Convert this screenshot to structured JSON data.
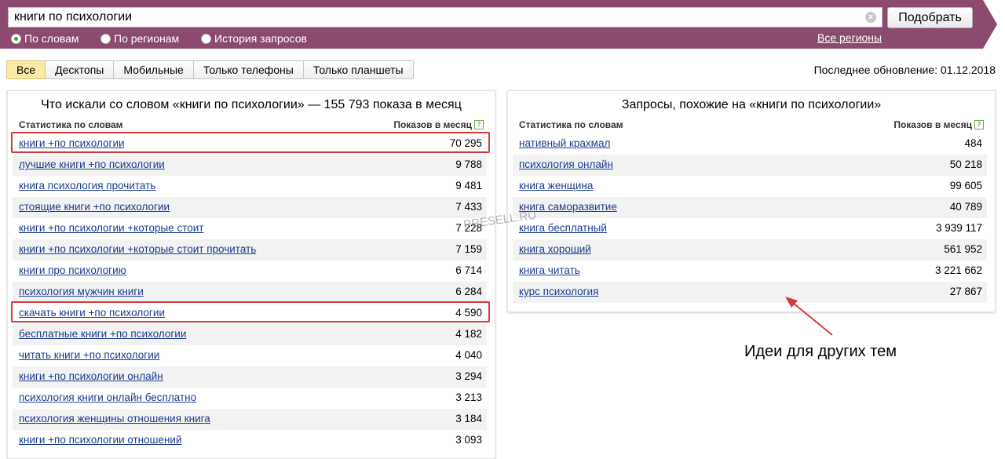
{
  "colors": {
    "header_band": "#8c4b6e",
    "link": "#1a3b8e",
    "highlight": "#d53a3a",
    "active_tab": "#fbe9a6"
  },
  "search": {
    "query": "книги по психологии",
    "button_label": "Подобрать",
    "clear_icon": "×"
  },
  "modes": [
    {
      "label": "По словам",
      "selected": true
    },
    {
      "label": "По регионам",
      "selected": false
    },
    {
      "label": "История запросов",
      "selected": false
    }
  ],
  "all_regions_label": "Все регионы",
  "device_tabs": [
    {
      "label": "Все",
      "active": true
    },
    {
      "label": "Десктопы",
      "active": false
    },
    {
      "label": "Мобильные",
      "active": false
    },
    {
      "label": "Только телефоны",
      "active": false
    },
    {
      "label": "Только планшеты",
      "active": false
    }
  ],
  "last_update": "Последнее обновление: 01.12.2018",
  "left_panel": {
    "title": "Что искали со словом «книги по психологии» — 155 793 показа в месяц",
    "col_query": "Статистика по словам",
    "col_count": "Показов в месяц",
    "help_icon": "?",
    "rows": [
      {
        "query": "книги +по психологии",
        "count": "70 295",
        "highlighted": true
      },
      {
        "query": "лучшие книги +по психологии",
        "count": "9 788"
      },
      {
        "query": "книга психология прочитать",
        "count": "9 481"
      },
      {
        "query": "стоящие книги +по психологии",
        "count": "7 433"
      },
      {
        "query": "книги +по психологии +которые стоит",
        "count": "7 228"
      },
      {
        "query": "книги +по психологии +которые стоит прочитать",
        "count": "7 159"
      },
      {
        "query": "книги про психологию",
        "count": "6 714"
      },
      {
        "query": "психология мужчин книги",
        "count": "6 284"
      },
      {
        "query": "скачать книги +по психологии",
        "count": "4 590",
        "highlighted": true
      },
      {
        "query": "бесплатные книги +по психологии",
        "count": "4 182"
      },
      {
        "query": "читать книги +по психологии",
        "count": "4 040"
      },
      {
        "query": "книги +по психологии онлайн",
        "count": "3 294"
      },
      {
        "query": "психология книги онлайн бесплатно",
        "count": "3 213"
      },
      {
        "query": "психология женщины отношения книга",
        "count": "3 184"
      },
      {
        "query": "книги +по психологии отношений",
        "count": "3 093"
      }
    ]
  },
  "right_panel": {
    "title": "Запросы, похожие на «книги по психологии»",
    "col_query": "Статистика по словам",
    "col_count": "Показов в месяц",
    "help_icon": "?",
    "rows": [
      {
        "query": "нативный крахмал",
        "count": "484"
      },
      {
        "query": "психология онлайн",
        "count": "50 218"
      },
      {
        "query": "книга женщина",
        "count": "99 605"
      },
      {
        "query": "книга саморазвитие",
        "count": "40 789"
      },
      {
        "query": "книга бесплатный",
        "count": "3 939 117"
      },
      {
        "query": "книга хороший",
        "count": "561 952"
      },
      {
        "query": "книга читать",
        "count": "3 221 662"
      },
      {
        "query": "курс психология",
        "count": "27 867"
      }
    ]
  },
  "annotation": "Идеи для других тем",
  "watermark": "PRESELL.RU"
}
